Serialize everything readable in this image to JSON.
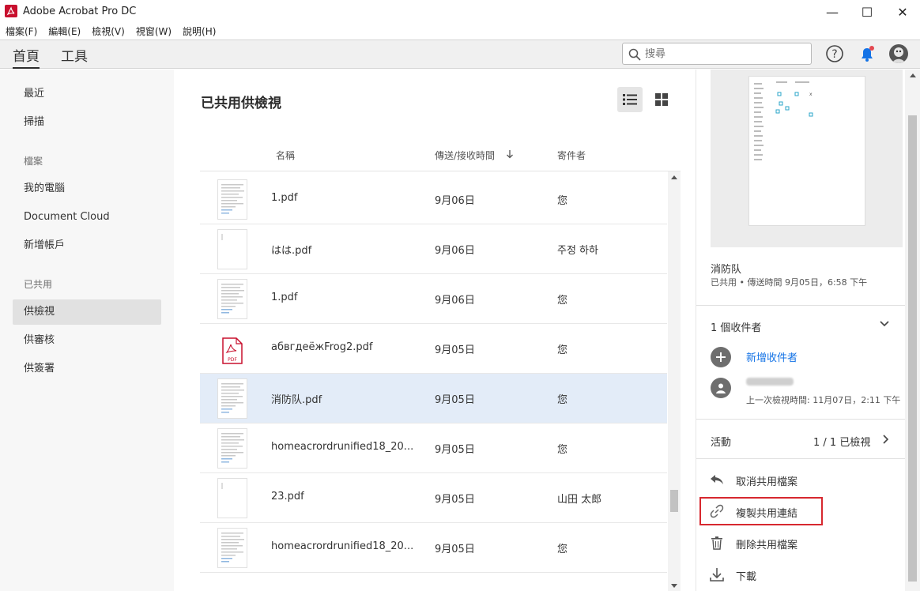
{
  "window": {
    "title": "Adobe Acrobat Pro DC",
    "minimize": "—",
    "maximize": "☐",
    "close": "✕"
  },
  "menu": [
    "檔案(F)",
    "編輯(E)",
    "檢視(V)",
    "視窗(W)",
    "說明(H)"
  ],
  "tabs": {
    "home": "首頁",
    "tools": "工具"
  },
  "search": {
    "placeholder": "搜尋"
  },
  "sidebar": {
    "recent": "最近",
    "scan": "掃描",
    "files_header": "檔案",
    "my_computer": "我的電腦",
    "document_cloud": "Document Cloud",
    "add_account": "新增帳戶",
    "shared_header": "已共用",
    "for_view": "供檢視",
    "for_review": "供審核",
    "for_sign": "供簽署"
  },
  "main": {
    "title": "已共用供檢視",
    "columns": {
      "name": "名稱",
      "time": "傳送/接收時間",
      "sender": "寄件者"
    },
    "sort_icon": "arrow-down-icon",
    "rows": [
      {
        "name": "1.pdf",
        "time": "9月06日",
        "sender": "您",
        "thumb": "doc-thumb"
      },
      {
        "name": "はは.pdf",
        "time": "9月06日",
        "sender": "주정 하하",
        "thumb": "blank-thumb"
      },
      {
        "name": "1.pdf",
        "time": "9月06日",
        "sender": "您",
        "thumb": "doc-thumb"
      },
      {
        "name": "абвгдеёжFrog2.pdf",
        "time": "9月05日",
        "sender": "您",
        "thumb": "pdf-icon"
      },
      {
        "name": "消防队.pdf",
        "time": "9月05日",
        "sender": "您",
        "thumb": "doc-thumb",
        "selected": true
      },
      {
        "name": "homeacrordrunified18_20...",
        "time": "9月05日",
        "sender": "您",
        "thumb": "doc-thumb"
      },
      {
        "name": "23.pdf",
        "time": "9月05日",
        "sender": "山田 太郎",
        "thumb": "blank-thumb"
      },
      {
        "name": "homeacrordrunified18_20...",
        "time": "9月05日",
        "sender": "您",
        "thumb": "doc-thumb"
      }
    ]
  },
  "details": {
    "file_name": "消防队",
    "meta": "已共用 • 傳送時間 9月05日，6:58 下午",
    "recipients_count": "1 個收件者",
    "add_recipient": "新增收件者",
    "last_viewed": "上一次檢視時間: 11月07日，2:11 下午",
    "activity_label": "活動",
    "activity_value": "1 / 1 已檢視",
    "actions": {
      "unshare": "取消共用檔案",
      "copy_link": "複製共用連結",
      "delete": "刪除共用檔案",
      "download": "下載"
    }
  },
  "colors": {
    "accent": "#1473e6",
    "highlight": "#d7282f",
    "selected_row": "#e3ecf8",
    "acrobat_red": "#c8102e"
  }
}
